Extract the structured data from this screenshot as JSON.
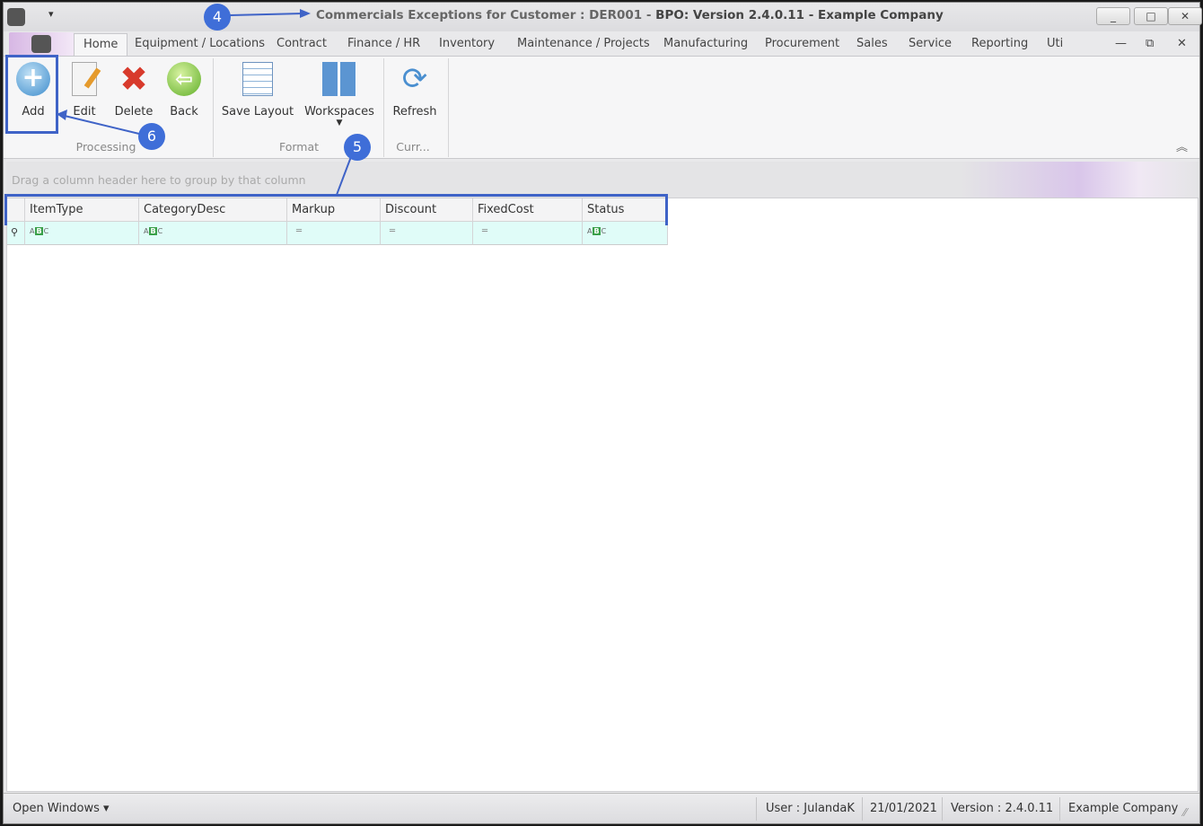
{
  "window": {
    "title_prefix": "Commercials Exceptions for Customer : DER001 - ",
    "title_main": "BPO: Version 2.4.0.11 - Example Company",
    "minimize": "_",
    "maximize": "□",
    "close": "✕",
    "quick_access": "▾"
  },
  "tabs": [
    "Home",
    "Equipment / Locations",
    "Contract",
    "Finance / HR",
    "Inventory",
    "Maintenance / Projects",
    "Manufacturing",
    "Procurement",
    "Sales",
    "Service",
    "Reporting",
    "Uti"
  ],
  "mdi": {
    "minimize": "—",
    "restore": "⧉",
    "close": "✕"
  },
  "ribbon": {
    "processing": {
      "label": "Processing",
      "add": "Add",
      "edit": "Edit",
      "delete": "Delete",
      "back": "Back"
    },
    "format": {
      "label": "Format",
      "save_layout": "Save Layout",
      "workspaces": "Workspaces"
    },
    "curr": {
      "label": "Curr...",
      "refresh": "Refresh"
    },
    "collapse": "︽"
  },
  "grid": {
    "group_hint": "Drag a column header here to group by that column",
    "columns": [
      "ItemType",
      "CategoryDesc",
      "Markup",
      "Discount",
      "FixedCost",
      "Status"
    ],
    "filter_icons": [
      "abc",
      "abc",
      "equals",
      "equals",
      "equals",
      "abc"
    ],
    "equals": "═"
  },
  "statusbar": {
    "open_windows": "Open Windows ▾",
    "user": "User : JulandaK",
    "date": "21/01/2021",
    "version": "Version : 2.4.0.11",
    "company": "Example Company"
  },
  "annotations": {
    "a4": "4",
    "a5": "5",
    "a6": "6"
  },
  "colors": {
    "accent": "#3f6ed8",
    "filter_row": "#e0fcf8"
  }
}
